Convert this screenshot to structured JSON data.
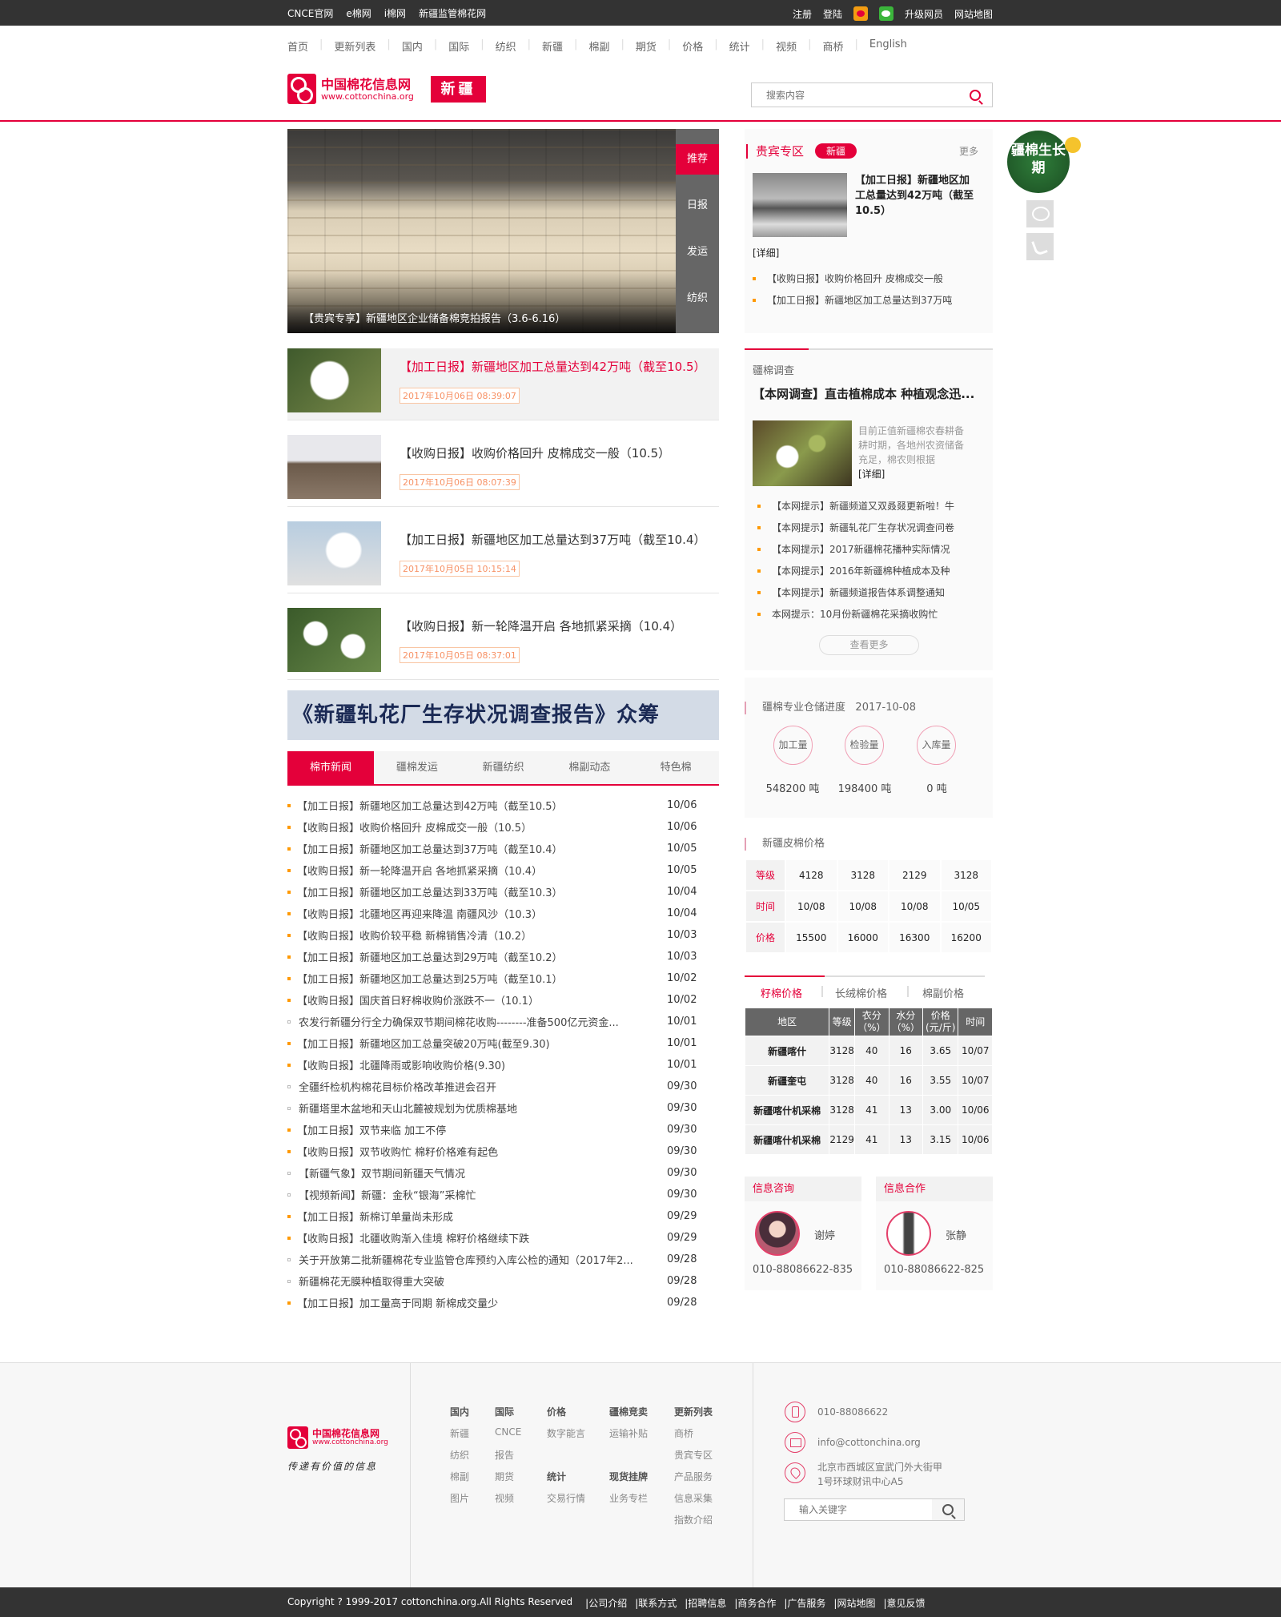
{
  "topbar": {
    "left_links": [
      "CNCE官网",
      "e棉网",
      "i棉网",
      "新疆监管棉花网"
    ],
    "register": "注册",
    "login": "登陆",
    "upgrade": "升级网员",
    "sitemap": "网站地图"
  },
  "nav": [
    "首页",
    "更新列表",
    "国内",
    "国际",
    "纺织",
    "新疆",
    "棉副",
    "期货",
    "价格",
    "统计",
    "视频",
    "商桥",
    "English"
  ],
  "header": {
    "logo_cn": "中国棉花信息网",
    "logo_en": "www.cottonchina.org",
    "region_badge": "新疆",
    "search_placeholder": "搜索内容"
  },
  "focus": {
    "caption": "【贵宾专享】新疆地区企业储备棉竞拍报告（3.6-6.16）",
    "tabs": [
      "推荐",
      "日报",
      "发运",
      "纺织"
    ],
    "active_tab": 0
  },
  "news_items": [
    {
      "title": "【加工日报】新疆地区加工总量达到42万吨（截至10.5）",
      "date": "2017年10月06日 08:39:07",
      "highlight": true
    },
    {
      "title": "【收购日报】收购价格回升 皮棉成交一般（10.5）",
      "date": "2017年10月06日 08:07:39",
      "highlight": false
    },
    {
      "title": "【加工日报】新疆地区加工总量达到37万吨（截至10.4）",
      "date": "2017年10月05日 10:15:14",
      "highlight": false
    },
    {
      "title": "【收购日报】新一轮降温开启 各地抓紧采摘（10.4）",
      "date": "2017年10月05日 08:37:01",
      "highlight": false
    }
  ],
  "banner": "《新疆轧花厂生存状况调查报告》众筹",
  "list_tabs": [
    "棉市新闻",
    "疆棉发运",
    "新疆纺织",
    "棉副动态",
    "特色棉"
  ],
  "news_list": [
    {
      "title": "【加工日报】新疆地区加工总量达到42万吨（截至10.5）",
      "date": "10/06",
      "tagged": true
    },
    {
      "title": "【收购日报】收购价格回升 皮棉成交一般（10.5）",
      "date": "10/06",
      "tagged": true
    },
    {
      "title": "【加工日报】新疆地区加工总量达到37万吨（截至10.4）",
      "date": "10/05",
      "tagged": true
    },
    {
      "title": "【收购日报】新一轮降温开启 各地抓紧采摘（10.4）",
      "date": "10/05",
      "tagged": true
    },
    {
      "title": "【加工日报】新疆地区加工总量达到33万吨（截至10.3）",
      "date": "10/04",
      "tagged": true
    },
    {
      "title": "【收购日报】北疆地区再迎来降温 南疆风沙（10.3）",
      "date": "10/04",
      "tagged": true
    },
    {
      "title": "【收购日报】收购价较平稳 新棉销售冷清（10.2）",
      "date": "10/03",
      "tagged": true
    },
    {
      "title": "【加工日报】新疆地区加工总量达到29万吨（截至10.2）",
      "date": "10/03",
      "tagged": true
    },
    {
      "title": "【加工日报】新疆地区加工总量达到25万吨（截至10.1）",
      "date": "10/02",
      "tagged": true
    },
    {
      "title": "【收购日报】国庆首日籽棉收购价涨跌不一（10.1）",
      "date": "10/02",
      "tagged": true
    },
    {
      "title": "农发行新疆分行全力确保双节期间棉花收购--------准备500亿元资金...",
      "date": "10/01",
      "tagged": false
    },
    {
      "title": "【加工日报】新疆地区加工总量突破20万吨(截至9.30)",
      "date": "10/01",
      "tagged": true
    },
    {
      "title": "【收购日报】北疆降雨或影响收购价格(9.30)",
      "date": "10/01",
      "tagged": true
    },
    {
      "title": "全疆纤检机构棉花目标价格改革推进会召开",
      "date": "09/30",
      "tagged": false
    },
    {
      "title": "新疆塔里木盆地和天山北麓被规划为优质棉基地",
      "date": "09/30",
      "tagged": false
    },
    {
      "title": "【加工日报】双节来临 加工不停",
      "date": "09/30",
      "tagged": true
    },
    {
      "title": "【收购日报】双节收购忙 棉籽价格难有起色",
      "date": "09/30",
      "tagged": true
    },
    {
      "title": "【新疆气象】双节期间新疆天气情况",
      "date": "09/30",
      "tagged": false
    },
    {
      "title": "【视频新闻】新疆：金秋“银海”采棉忙",
      "date": "09/30",
      "tagged": false
    },
    {
      "title": "【加工日报】新棉订单量尚未形成",
      "date": "09/29",
      "tagged": true
    },
    {
      "title": "【收购日报】北疆收购渐入佳境 棉籽价格继续下跌",
      "date": "09/29",
      "tagged": true
    },
    {
      "title": "关于开放第二批新疆棉花专业监管仓库预约入库公检的通知（2017年2...",
      "date": "09/28",
      "tagged": false
    },
    {
      "title": "新疆棉花无膜种植取得重大突破",
      "date": "09/28",
      "tagged": false
    },
    {
      "title": "【加工日报】加工量高于同期 新棉成交量少",
      "date": "09/28",
      "tagged": true
    }
  ],
  "vip": {
    "title": "贵宾专区",
    "tag": "新疆",
    "more": "更多",
    "feature_title": "【加工日报】新疆地区加工总量达到42万吨（截至10.5）",
    "detail": "[详细]",
    "items": [
      "【收购日报】收购价格回升 皮棉成交一般",
      "【加工日报】新疆地区加工总量达到37万吨"
    ]
  },
  "survey": {
    "section": "疆棉调查",
    "title": "【本网调查】直击植棉成本 种植观念迅...",
    "desc": "目前正值新疆棉农春耕备耕时期，各地州农资储备充足，棉农则根据",
    "detail": "[详细]",
    "items": [
      "【本网提示】新疆频道又双叒叕更新啦！牛",
      "【本网提示】新疆轧花厂生存状况调查问卷",
      "【本网提示】2017新疆棉花播种实际情况",
      "【本网提示】2016年新疆棉种植成本及种",
      "【本网提示】新疆频道报告体系调整通知",
      "本网提示：10月份新疆棉花采摘收购忙"
    ],
    "more_button": "查看更多"
  },
  "storage": {
    "title": "疆棉专业仓储进度",
    "date": "2017-10-08",
    "metrics": [
      {
        "label": "加工量",
        "value": "548200 吨"
      },
      {
        "label": "检验量",
        "value": "198400 吨"
      },
      {
        "label": "入库量",
        "value": "0 吨"
      }
    ]
  },
  "lint_price": {
    "title": "新疆皮棉价格",
    "rows": [
      {
        "label": "等级",
        "values": [
          "4128",
          "3128",
          "2129",
          "3128"
        ]
      },
      {
        "label": "时间",
        "values": [
          "10/08",
          "10/08",
          "10/08",
          "10/05"
        ]
      },
      {
        "label": "价格",
        "values": [
          "15500",
          "16000",
          "16300",
          "16200"
        ]
      }
    ]
  },
  "seed_price": {
    "tabs": [
      "籽棉价格",
      "长绒棉价格",
      "棉副价格"
    ],
    "headers": [
      "地区",
      "等级",
      "衣分（%）",
      "水分（%）",
      "价格(元/斤)",
      "时间"
    ],
    "rows": [
      [
        "新疆喀什",
        "3128",
        "40",
        "16",
        "3.65",
        "10/07"
      ],
      [
        "新疆奎屯",
        "3128",
        "40",
        "16",
        "3.55",
        "10/07"
      ],
      [
        "新疆喀什机采棉",
        "3128",
        "41",
        "13",
        "3.00",
        "10/06"
      ],
      [
        "新疆喀什机采棉",
        "2129",
        "41",
        "13",
        "3.15",
        "10/06"
      ]
    ]
  },
  "contacts": [
    {
      "title": "信息咨询",
      "name": "谢婷",
      "phone": "010-88086622-835"
    },
    {
      "title": "信息合作",
      "name": "张静",
      "phone": "010-88086622-825"
    }
  ],
  "float_badge": "疆棉生长期",
  "footer": {
    "logo_cn": "中国棉花信息网",
    "logo_en": "www.cottonchina.org",
    "tagline": "传递有价值的信息",
    "columns": [
      [
        "国内",
        "新疆",
        "纺织",
        "棉副",
        "图片"
      ],
      [
        "国际",
        "CNCE",
        "报告",
        "期货",
        "视频"
      ],
      [
        "价格",
        "数字能言",
        "",
        "统计",
        "交易行情"
      ],
      [
        "疆棉竞卖",
        "运输补贴",
        "",
        "现货挂牌",
        "业务专栏"
      ],
      [
        "更新列表",
        "商桥",
        "贵宾专区",
        "产品服务",
        "信息采集",
        "指数介绍"
      ]
    ],
    "phone": "010-88086622",
    "email": "info@cottonchina.org",
    "address_line1": "北京市西城区宣武门外大街甲",
    "address_line2": "1号环球财讯中心A5",
    "search_placeholder": "输入关键字"
  },
  "bottom": {
    "copyright": "Copyright ? 1999-2017 cottonchina.org.All Rights Reserved",
    "links": [
      "|公司介绍",
      "|联系方式",
      "|招聘信息",
      "|商务合作",
      "|广告服务",
      "|网站地图",
      "|意见反馈"
    ]
  }
}
